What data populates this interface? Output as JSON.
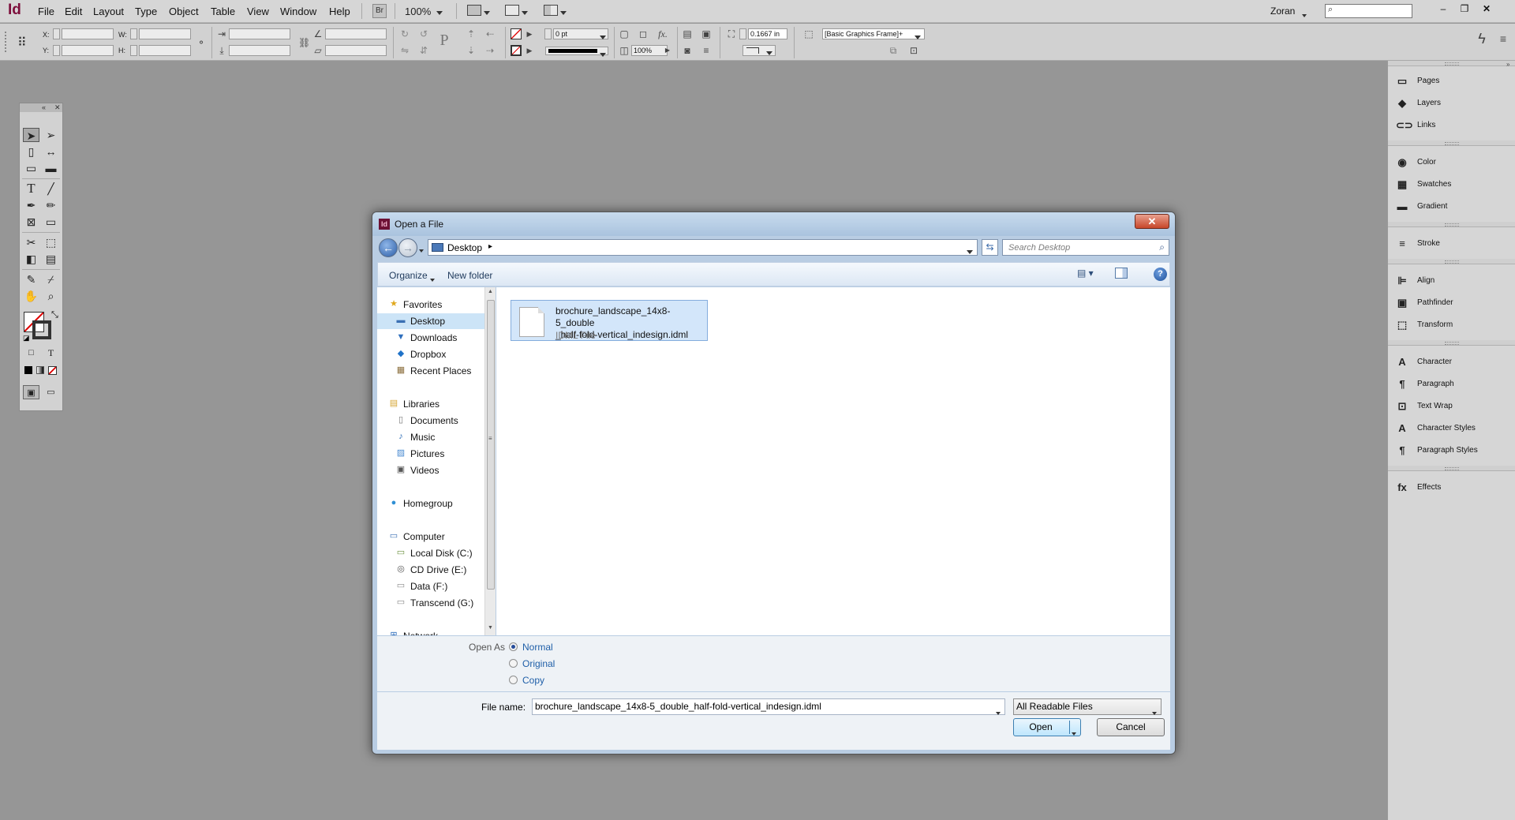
{
  "app": {
    "logo": "Id",
    "menu": [
      "File",
      "Edit",
      "Layout",
      "Type",
      "Object",
      "Table",
      "View",
      "Window",
      "Help"
    ],
    "bridge_label": "Br",
    "zoom": "100%",
    "user": "Zoran",
    "window_controls": {
      "minimize": "–",
      "restore": "❐",
      "close": "✕"
    }
  },
  "control_panel": {
    "x_label": "X:",
    "y_label": "Y:",
    "w_label": "W:",
    "h_label": "H:",
    "stroke_weight": "0 pt",
    "opacity": "100%",
    "fit_value": "0.1667 in",
    "object_style": "[Basic Graphics Frame]+"
  },
  "panels": {
    "groups": [
      [
        {
          "icon": "pages-icon",
          "glyph": "▭",
          "label": "Pages"
        },
        {
          "icon": "layers-icon",
          "glyph": "◆",
          "label": "Layers"
        },
        {
          "icon": "links-icon",
          "glyph": "⊂⊃",
          "label": "Links"
        }
      ],
      [
        {
          "icon": "color-icon",
          "glyph": "◉",
          "label": "Color"
        },
        {
          "icon": "swatches-icon",
          "glyph": "▦",
          "label": "Swatches"
        },
        {
          "icon": "gradient-icon",
          "glyph": "▬",
          "label": "Gradient"
        }
      ],
      [
        {
          "icon": "stroke-icon",
          "glyph": "≡",
          "label": "Stroke"
        }
      ],
      [
        {
          "icon": "align-icon",
          "glyph": "⊫",
          "label": "Align"
        },
        {
          "icon": "pathfinder-icon",
          "glyph": "▣",
          "label": "Pathfinder"
        },
        {
          "icon": "transform-icon",
          "glyph": "⬚",
          "label": "Transform"
        }
      ],
      [
        {
          "icon": "character-icon",
          "glyph": "A",
          "label": "Character"
        },
        {
          "icon": "paragraph-icon",
          "glyph": "¶",
          "label": "Paragraph"
        },
        {
          "icon": "text-wrap-icon",
          "glyph": "⊡",
          "label": "Text Wrap"
        },
        {
          "icon": "character-styles-icon",
          "glyph": "A",
          "label": "Character Styles"
        },
        {
          "icon": "paragraph-styles-icon",
          "glyph": "¶",
          "label": "Paragraph Styles"
        }
      ],
      [
        {
          "icon": "effects-icon",
          "glyph": "fx",
          "label": "Effects"
        }
      ]
    ]
  },
  "dialog": {
    "title": "Open a File",
    "close_glyph": "✕",
    "address": {
      "location": "Desktop",
      "search_placeholder": "Search Desktop"
    },
    "commands": {
      "organize": "Organize",
      "new_folder": "New folder",
      "help": "?"
    },
    "nav": [
      {
        "label": "Favorites",
        "icon": "favorites-star-icon",
        "glyph": "★",
        "color": "#e0a81d",
        "indent": 0
      },
      {
        "label": "Desktop",
        "icon": "desktop-folder-icon",
        "glyph": "▬",
        "color": "#3a6fb3",
        "indent": 1,
        "selected": true
      },
      {
        "label": "Downloads",
        "icon": "downloads-folder-icon",
        "glyph": "▼",
        "color": "#2f6fbd",
        "indent": 1
      },
      {
        "label": "Dropbox",
        "icon": "dropbox-icon",
        "glyph": "◆",
        "color": "#1f72c8",
        "indent": 1
      },
      {
        "label": "Recent Places",
        "icon": "recent-places-icon",
        "glyph": "▦",
        "color": "#8a6d3b",
        "indent": 1
      },
      {
        "label": "Libraries",
        "icon": "libraries-icon",
        "glyph": "▤",
        "color": "#d6a634",
        "indent": 0
      },
      {
        "label": "Documents",
        "icon": "documents-icon",
        "glyph": "▯",
        "color": "#777",
        "indent": 1
      },
      {
        "label": "Music",
        "icon": "music-icon",
        "glyph": "♪",
        "color": "#2c6cb5",
        "indent": 1
      },
      {
        "label": "Pictures",
        "icon": "pictures-icon",
        "glyph": "▨",
        "color": "#4a8bd1",
        "indent": 1
      },
      {
        "label": "Videos",
        "icon": "videos-icon",
        "glyph": "▣",
        "color": "#555",
        "indent": 1
      },
      {
        "label": "Homegroup",
        "icon": "homegroup-icon",
        "glyph": "●",
        "color": "#2f8fd4",
        "indent": 0
      },
      {
        "label": "Computer",
        "icon": "computer-icon",
        "glyph": "▭",
        "color": "#3a6fb3",
        "indent": 0
      },
      {
        "label": "Local Disk (C:)",
        "icon": "local-disk-icon",
        "glyph": "▭",
        "color": "#6a8f3c",
        "indent": 1
      },
      {
        "label": "CD Drive (E:)",
        "icon": "cd-drive-icon",
        "glyph": "◎",
        "color": "#555",
        "indent": 1
      },
      {
        "label": "Data (F:)",
        "icon": "data-drive-icon",
        "glyph": "▭",
        "color": "#888",
        "indent": 1
      },
      {
        "label": "Transcend (G:)",
        "icon": "transcend-drive-icon",
        "glyph": "▭",
        "color": "#888",
        "indent": 1
      },
      {
        "label": "Network",
        "icon": "network-icon",
        "glyph": "⊞",
        "color": "#2f6fbd",
        "indent": 0
      }
    ],
    "file": {
      "name": "brochure_landscape_14x8-5_double_half-fold-vertical_indesign.idml",
      "name_display": "brochure_landscape_14x8-5_double\n_half-fold-vertical_indesign.idml",
      "type": "IDML File"
    },
    "open_as": {
      "label": "Open As",
      "options": [
        "Normal",
        "Original",
        "Copy"
      ],
      "selected": "Normal"
    },
    "file_name_label": "File name:",
    "file_name_value": "brochure_landscape_14x8-5_double_half-fold-vertical_indesign.idml",
    "file_type": "All Readable Files",
    "open_button": "Open",
    "cancel_button": "Cancel"
  }
}
